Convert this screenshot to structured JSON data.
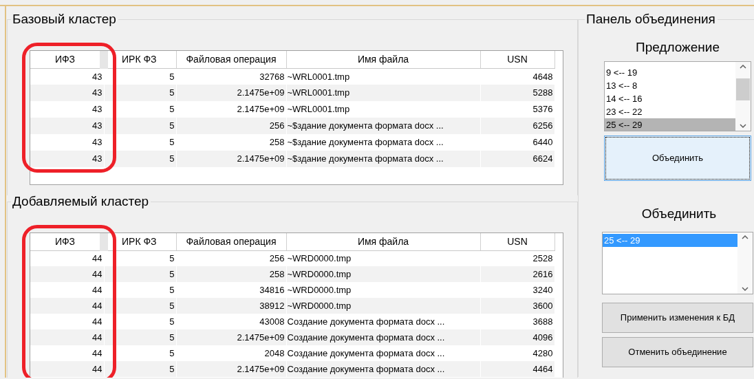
{
  "clusters": [
    {
      "title": "Базовый кластер",
      "columns": [
        {
          "label": "ИФЗ",
          "highlighted": true
        },
        {
          "label": "ИРК ФЗ",
          "highlighted": false
        },
        {
          "label": "Файловая операция",
          "highlighted": false
        },
        {
          "label": "Имя файла",
          "highlighted": false
        },
        {
          "label": "USN",
          "highlighted": false
        }
      ],
      "rows": [
        [
          "43",
          "5",
          "32768",
          "~WRL0001.tmp",
          "4648"
        ],
        [
          "43",
          "5",
          "2.1475e+09",
          "~WRL0001.tmp",
          "5288"
        ],
        [
          "43",
          "5",
          "2.1475e+09",
          "~WRL0001.tmp",
          "5376"
        ],
        [
          "43",
          "5",
          "256",
          "~$здание документа формата docx ...",
          "6256"
        ],
        [
          "43",
          "5",
          "258",
          "~$здание документа формата docx ...",
          "6440"
        ],
        [
          "43",
          "5",
          "2.1475e+09",
          "~$здание документа формата docx ...",
          "6624"
        ]
      ]
    },
    {
      "title": "Добавляемый кластер",
      "columns": [
        {
          "label": "ИФЗ",
          "highlighted": true
        },
        {
          "label": "ИРК ФЗ",
          "highlighted": false
        },
        {
          "label": "Файловая операция",
          "highlighted": false
        },
        {
          "label": "Имя файла",
          "highlighted": false
        },
        {
          "label": "USN",
          "highlighted": false
        }
      ],
      "rows": [
        [
          "44",
          "5",
          "256",
          "~WRD0000.tmp",
          "2528"
        ],
        [
          "44",
          "5",
          "258",
          "~WRD0000.tmp",
          "2616"
        ],
        [
          "44",
          "5",
          "34816",
          "~WRD0000.tmp",
          "3240"
        ],
        [
          "44",
          "5",
          "38912",
          "~WRD0000.tmp",
          "3600"
        ],
        [
          "44",
          "5",
          "43008",
          "Создание документа формата docx ...",
          "3688"
        ],
        [
          "44",
          "5",
          "2.1475e+09",
          "Создание документа формата docx ...",
          "4096"
        ],
        [
          "44",
          "5",
          "2048",
          "Создание документа формата docx ...",
          "4280"
        ],
        [
          "44",
          "5",
          "2.1475e+09",
          "Создание документа формата docx ...",
          "4464"
        ]
      ]
    }
  ],
  "panel": {
    "title": "Панель объединения",
    "proposal": {
      "label": "Предложение",
      "focused": false,
      "items": [
        {
          "text": "9 <-- 19",
          "selected": false
        },
        {
          "text": "13 <-- 8",
          "selected": false
        },
        {
          "text": "14 <-- 16",
          "selected": false
        },
        {
          "text": "23 <-- 22",
          "selected": false
        },
        {
          "text": "25 <-- 29",
          "selected": true
        }
      ]
    },
    "merge_button": {
      "label": "Объединить",
      "focused": true
    },
    "merge": {
      "label": "Объединить",
      "focused": true,
      "items": [
        {
          "text": "25 <-- 29",
          "selected": true
        }
      ]
    },
    "buttons": [
      {
        "label": "Применить изменения к БД",
        "focused": false
      },
      {
        "label": "Отменить объединение",
        "focused": false
      }
    ]
  }
}
